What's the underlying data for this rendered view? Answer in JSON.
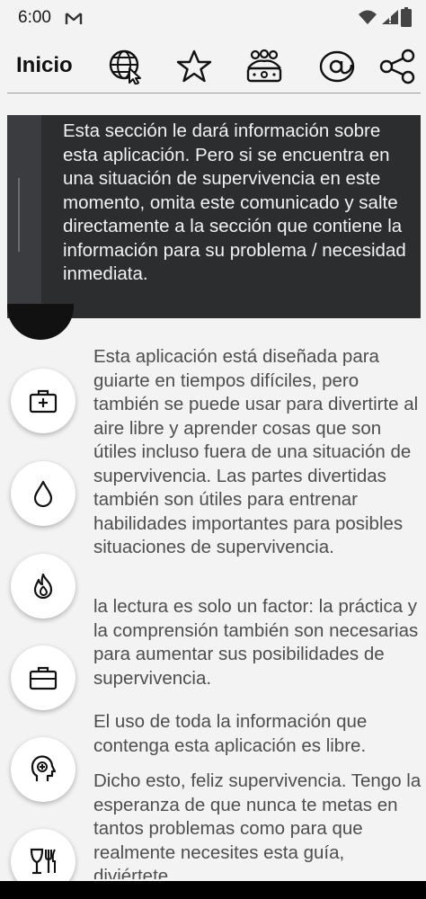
{
  "status_bar": {
    "time": "6:00"
  },
  "app_bar": {
    "title": "Inicio",
    "icons": [
      "globe-cursor-icon",
      "star-icon",
      "group-icon",
      "at-sign-icon",
      "share-icon"
    ]
  },
  "intro": {
    "text": "Esta sección le dará información sobre esta aplicación. Pero si se encuentra en una situación de supervivencia en este momento, omita este comunicado y salte directamente a la sección que contiene la información para su problema / necesidad inmediata."
  },
  "body": {
    "paragraph1": "Esta aplicación está diseñada para guiarte en tiempos difíciles, pero también se puede usar para divertirte al aire libre y aprender cosas que son útiles incluso fuera de una situación de supervivencia. Las partes divertidas también son útiles para entrenar habilidades importantes para posibles situaciones de supervivencia.",
    "paragraph2": "la lectura es solo un factor: la práctica y la comprensión también son necesarias para aumentar sus posibilidades de supervivencia.",
    "paragraph3": "El uso de toda la información que contenga esta aplicación es libre.",
    "paragraph4": "Dicho esto, feliz supervivencia. Tengo la esperanza de que nunca te metas en tantos problemas como para que realmente necesites esta guía, diviértete"
  },
  "side_buttons": [
    "first-aid-kit-icon",
    "water-drop-icon",
    "fire-icon",
    "toolbox-icon",
    "mind-icon",
    "food-utensils-icon"
  ],
  "colors": {
    "background": "#f3f3f3",
    "panel": "#2c2d2f",
    "body_text": "#4e4e4e"
  }
}
